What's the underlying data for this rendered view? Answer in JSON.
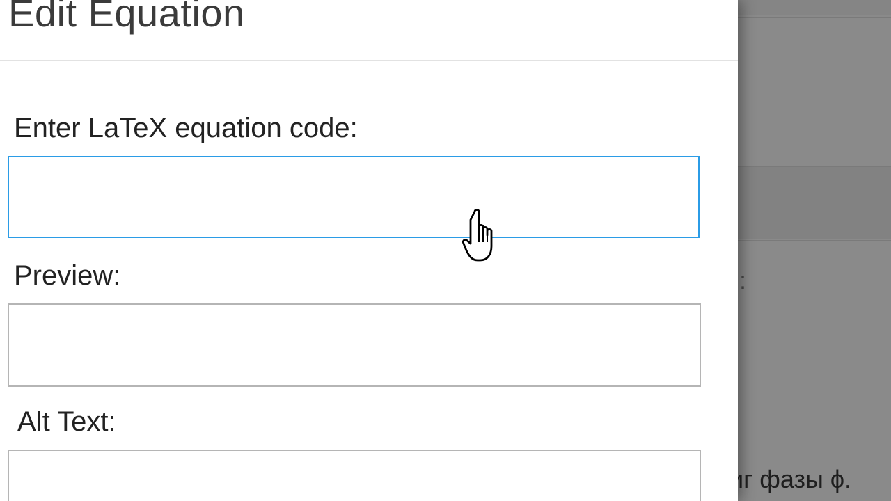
{
  "dialog": {
    "title": "Edit Equation",
    "latex": {
      "label": "Enter LaTeX equation code:",
      "value": ""
    },
    "preview": {
      "label": "Preview:"
    },
    "alt_text": {
      "label": "Alt Text:",
      "value": ""
    }
  },
  "background": {
    "colon": ":",
    "text_snippet": "иг фазы ϕ."
  },
  "cursor": {
    "icon": "hand-pointer-icon"
  },
  "colors": {
    "focus_border": "#2b9ce6",
    "field_border": "#b5b5b5",
    "overlay": "#8a8a8a"
  }
}
